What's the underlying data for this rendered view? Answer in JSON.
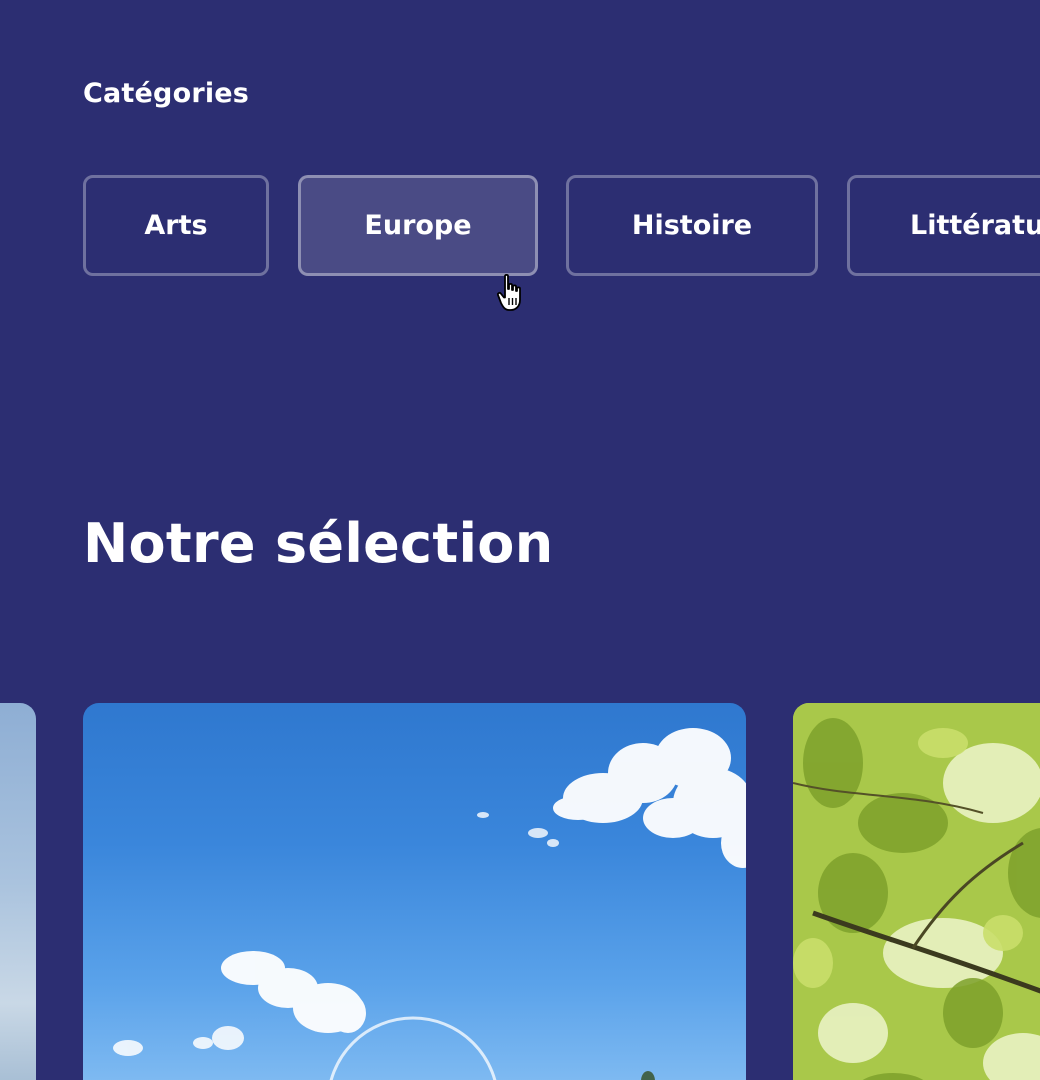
{
  "categories": {
    "label": "Catégories",
    "items": [
      {
        "label": "Arts"
      },
      {
        "label": "Europe",
        "state": "hover"
      },
      {
        "label": "Histoire"
      },
      {
        "label": "Littératu"
      }
    ]
  },
  "selection": {
    "title": "Notre sélection"
  },
  "colors": {
    "background": "#2c2e72",
    "chip_border": "rgba(255,255,255,0.32)",
    "chip_hover": "#4a4b85"
  },
  "icons": {
    "cursor": "hand-pointer-icon"
  }
}
